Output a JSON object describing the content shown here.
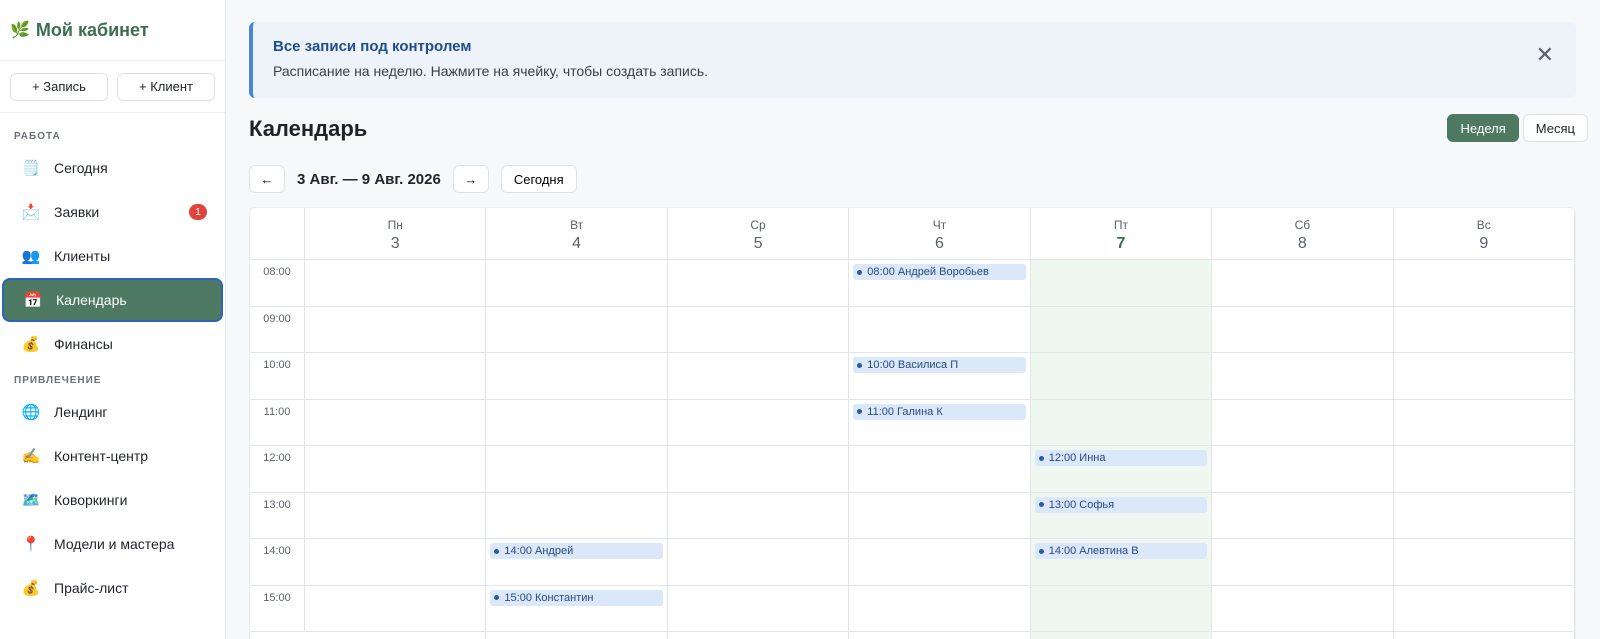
{
  "sidebar": {
    "brand": {
      "icon": "🌿",
      "title": "Мой кабинет"
    },
    "actions": {
      "add_entry": "+ Запись",
      "add_client": "+ Клиент"
    },
    "sections": [
      {
        "label": "РАБОТА",
        "items": [
          {
            "icon": "🗒️",
            "label": "Сегодня"
          },
          {
            "icon": "📩",
            "label": "Заявки",
            "badge": "1"
          },
          {
            "icon": "👥",
            "label": "Клиенты"
          },
          {
            "icon": "📅",
            "label": "Календарь",
            "active": true
          },
          {
            "icon": "💰",
            "label": "Финансы"
          }
        ]
      },
      {
        "label": "ПРИВЛЕЧЕНИЕ",
        "items": [
          {
            "icon": "🌐",
            "label": "Лендинг"
          },
          {
            "icon": "✍️",
            "label": "Контент-центр"
          },
          {
            "icon": "🗺️",
            "label": "Коворкинги"
          },
          {
            "icon": "📍",
            "label": "Модели и мастера"
          },
          {
            "icon": "💰",
            "label": "Прайс-лист"
          }
        ]
      }
    ]
  },
  "alert": {
    "title": "Все записи под контролем",
    "text": "Расписание на неделю. Нажмите на ячейку, чтобы создать запись.",
    "close": "✕"
  },
  "page": {
    "title": "Календарь"
  },
  "view_switch": {
    "week": "Неделя",
    "month": "Месяц",
    "active": "week"
  },
  "week_nav": {
    "prev": "←",
    "next": "→",
    "range": "3 Авг. — 9 Авг. 2026",
    "today": "Сегодня"
  },
  "calendar": {
    "days": [
      {
        "name": "Пн",
        "num": "3"
      },
      {
        "name": "Вт",
        "num": "4"
      },
      {
        "name": "Ср",
        "num": "5"
      },
      {
        "name": "Чт",
        "num": "6"
      },
      {
        "name": "Пт",
        "num": "7",
        "today": true
      },
      {
        "name": "Сб",
        "num": "8"
      },
      {
        "name": "Вс",
        "num": "9"
      }
    ],
    "hours": [
      "08:00",
      "09:00",
      "10:00",
      "11:00",
      "12:00",
      "13:00",
      "14:00",
      "15:00"
    ],
    "events": [
      {
        "day": 3,
        "hour": 0,
        "label": "08:00 Андрей Воробьев"
      },
      {
        "day": 3,
        "hour": 2,
        "label": "10:00 Василиса П"
      },
      {
        "day": 3,
        "hour": 3,
        "label": "11:00 Галина К"
      },
      {
        "day": 4,
        "hour": 4,
        "label": "12:00 Инна"
      },
      {
        "day": 4,
        "hour": 5,
        "label": "13:00 Софья"
      },
      {
        "day": 4,
        "hour": 6,
        "label": "14:00 Алевтина В"
      },
      {
        "day": 1,
        "hour": 6,
        "label": "14:00 Андрей"
      },
      {
        "day": 1,
        "hour": 7,
        "label": "15:00 Константин"
      }
    ]
  }
}
